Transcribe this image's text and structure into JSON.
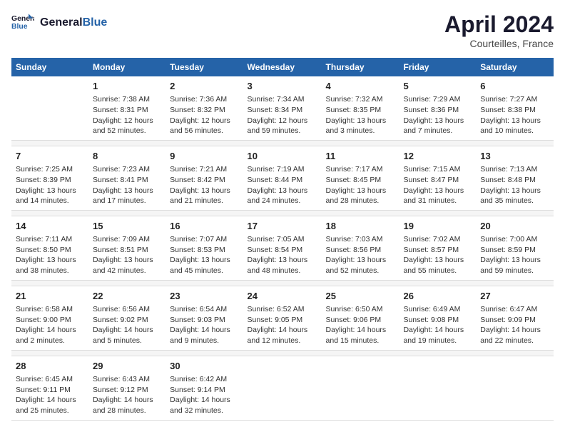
{
  "header": {
    "logo_line1": "General",
    "logo_line2": "Blue",
    "month": "April 2024",
    "location": "Courteilles, France"
  },
  "days_of_week": [
    "Sunday",
    "Monday",
    "Tuesday",
    "Wednesday",
    "Thursday",
    "Friday",
    "Saturday"
  ],
  "weeks": [
    [
      {
        "day": "",
        "info": ""
      },
      {
        "day": "1",
        "info": "Sunrise: 7:38 AM\nSunset: 8:31 PM\nDaylight: 12 hours\nand 52 minutes."
      },
      {
        "day": "2",
        "info": "Sunrise: 7:36 AM\nSunset: 8:32 PM\nDaylight: 12 hours\nand 56 minutes."
      },
      {
        "day": "3",
        "info": "Sunrise: 7:34 AM\nSunset: 8:34 PM\nDaylight: 12 hours\nand 59 minutes."
      },
      {
        "day": "4",
        "info": "Sunrise: 7:32 AM\nSunset: 8:35 PM\nDaylight: 13 hours\nand 3 minutes."
      },
      {
        "day": "5",
        "info": "Sunrise: 7:29 AM\nSunset: 8:36 PM\nDaylight: 13 hours\nand 7 minutes."
      },
      {
        "day": "6",
        "info": "Sunrise: 7:27 AM\nSunset: 8:38 PM\nDaylight: 13 hours\nand 10 minutes."
      }
    ],
    [
      {
        "day": "7",
        "info": "Sunrise: 7:25 AM\nSunset: 8:39 PM\nDaylight: 13 hours\nand 14 minutes."
      },
      {
        "day": "8",
        "info": "Sunrise: 7:23 AM\nSunset: 8:41 PM\nDaylight: 13 hours\nand 17 minutes."
      },
      {
        "day": "9",
        "info": "Sunrise: 7:21 AM\nSunset: 8:42 PM\nDaylight: 13 hours\nand 21 minutes."
      },
      {
        "day": "10",
        "info": "Sunrise: 7:19 AM\nSunset: 8:44 PM\nDaylight: 13 hours\nand 24 minutes."
      },
      {
        "day": "11",
        "info": "Sunrise: 7:17 AM\nSunset: 8:45 PM\nDaylight: 13 hours\nand 28 minutes."
      },
      {
        "day": "12",
        "info": "Sunrise: 7:15 AM\nSunset: 8:47 PM\nDaylight: 13 hours\nand 31 minutes."
      },
      {
        "day": "13",
        "info": "Sunrise: 7:13 AM\nSunset: 8:48 PM\nDaylight: 13 hours\nand 35 minutes."
      }
    ],
    [
      {
        "day": "14",
        "info": "Sunrise: 7:11 AM\nSunset: 8:50 PM\nDaylight: 13 hours\nand 38 minutes."
      },
      {
        "day": "15",
        "info": "Sunrise: 7:09 AM\nSunset: 8:51 PM\nDaylight: 13 hours\nand 42 minutes."
      },
      {
        "day": "16",
        "info": "Sunrise: 7:07 AM\nSunset: 8:53 PM\nDaylight: 13 hours\nand 45 minutes."
      },
      {
        "day": "17",
        "info": "Sunrise: 7:05 AM\nSunset: 8:54 PM\nDaylight: 13 hours\nand 48 minutes."
      },
      {
        "day": "18",
        "info": "Sunrise: 7:03 AM\nSunset: 8:56 PM\nDaylight: 13 hours\nand 52 minutes."
      },
      {
        "day": "19",
        "info": "Sunrise: 7:02 AM\nSunset: 8:57 PM\nDaylight: 13 hours\nand 55 minutes."
      },
      {
        "day": "20",
        "info": "Sunrise: 7:00 AM\nSunset: 8:59 PM\nDaylight: 13 hours\nand 59 minutes."
      }
    ],
    [
      {
        "day": "21",
        "info": "Sunrise: 6:58 AM\nSunset: 9:00 PM\nDaylight: 14 hours\nand 2 minutes."
      },
      {
        "day": "22",
        "info": "Sunrise: 6:56 AM\nSunset: 9:02 PM\nDaylight: 14 hours\nand 5 minutes."
      },
      {
        "day": "23",
        "info": "Sunrise: 6:54 AM\nSunset: 9:03 PM\nDaylight: 14 hours\nand 9 minutes."
      },
      {
        "day": "24",
        "info": "Sunrise: 6:52 AM\nSunset: 9:05 PM\nDaylight: 14 hours\nand 12 minutes."
      },
      {
        "day": "25",
        "info": "Sunrise: 6:50 AM\nSunset: 9:06 PM\nDaylight: 14 hours\nand 15 minutes."
      },
      {
        "day": "26",
        "info": "Sunrise: 6:49 AM\nSunset: 9:08 PM\nDaylight: 14 hours\nand 19 minutes."
      },
      {
        "day": "27",
        "info": "Sunrise: 6:47 AM\nSunset: 9:09 PM\nDaylight: 14 hours\nand 22 minutes."
      }
    ],
    [
      {
        "day": "28",
        "info": "Sunrise: 6:45 AM\nSunset: 9:11 PM\nDaylight: 14 hours\nand 25 minutes."
      },
      {
        "day": "29",
        "info": "Sunrise: 6:43 AM\nSunset: 9:12 PM\nDaylight: 14 hours\nand 28 minutes."
      },
      {
        "day": "30",
        "info": "Sunrise: 6:42 AM\nSunset: 9:14 PM\nDaylight: 14 hours\nand 32 minutes."
      },
      {
        "day": "",
        "info": ""
      },
      {
        "day": "",
        "info": ""
      },
      {
        "day": "",
        "info": ""
      },
      {
        "day": "",
        "info": ""
      }
    ]
  ]
}
